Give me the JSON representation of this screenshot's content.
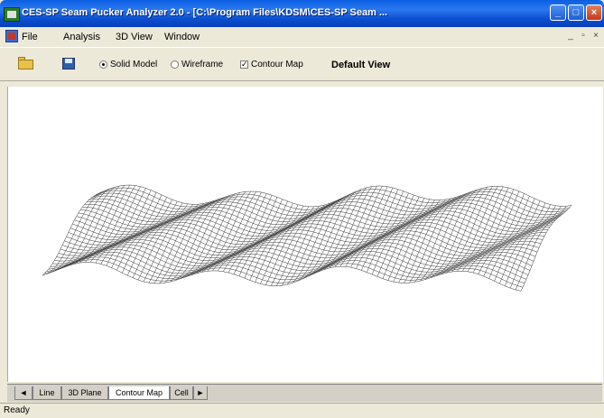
{
  "window": {
    "title": "CES-SP Seam Pucker Analyzer 2.0 - [C:\\Program Files\\KDSM\\CES-SP Seam ...",
    "controls": {
      "minimize": "_",
      "maximize": "□",
      "close": "×"
    }
  },
  "menu": {
    "items": [
      "File",
      "Analysis",
      "3D View",
      "Window"
    ],
    "mdi": {
      "minimize": "_",
      "restore": "▫",
      "close": "×"
    }
  },
  "toolbar": {
    "solid_model": {
      "label": "Solid Model",
      "selected": true
    },
    "wireframe": {
      "label": "Wireframe",
      "selected": false
    },
    "contour_map": {
      "label": "Contour Map",
      "checked": true
    },
    "default_view": "Default View"
  },
  "tabs": {
    "nav_left": "◄",
    "items": [
      "Line",
      "3D Plane",
      "Contour Map",
      "Cell"
    ],
    "active": "Contour Map",
    "nav_right": "►"
  },
  "status": {
    "text": "Ready"
  },
  "colors": {
    "title_bar": "#0a5fe3",
    "surface_stroke": "#333333",
    "canvas_bg": "#ffffff"
  },
  "icons": {
    "open": "folder-open-icon",
    "save": "save-disk-icon"
  }
}
